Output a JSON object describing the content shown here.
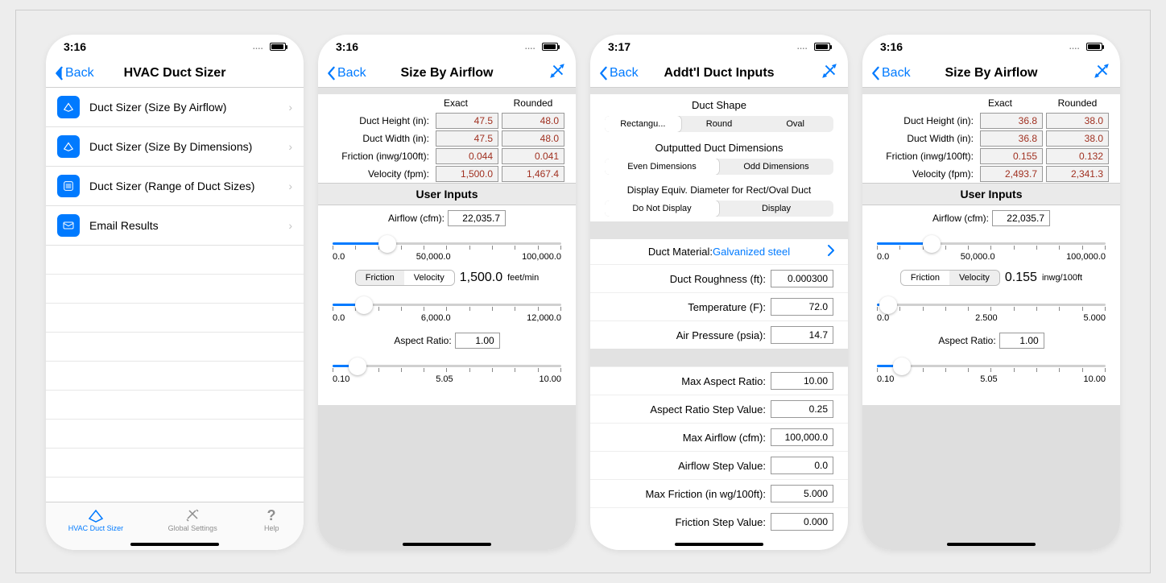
{
  "status": {
    "t1": "3:16",
    "t2": "3:16",
    "t3": "3:17",
    "t4": "3:16"
  },
  "s1": {
    "back": "Back",
    "title": "HVAC Duct Sizer",
    "rows": [
      "Duct Sizer (Size By Airflow)",
      "Duct Sizer (Size By Dimensions)",
      "Duct Sizer (Range of Duct Sizes)",
      "Email Results"
    ],
    "tabs": {
      "a": "HVAC Duct Sizer",
      "b": "Global Settings",
      "c": "Help"
    }
  },
  "s2": {
    "back": "Back",
    "title": "Size By Airflow",
    "hdr_exact": "Exact",
    "hdr_rounded": "Rounded",
    "r1l": "Duct Height (in):",
    "r1e": "47.5",
    "r1r": "48.0",
    "r2l": "Duct Width (in):",
    "r2e": "47.5",
    "r2r": "48.0",
    "r3l": "Friction (inwg/100ft):",
    "r3e": "0.044",
    "r3r": "0.041",
    "r4l": "Velocity (fpm):",
    "r4e": "1,500.0",
    "r4r": "1,467.4",
    "user_inputs": "User Inputs",
    "airflow_l": "Airflow (cfm):",
    "airflow_v": "22,035.7",
    "sl1": {
      "a": "0.0",
      "b": "50,000.0",
      "c": "100,000.0"
    },
    "seg_friction": "Friction",
    "seg_velocity": "Velocity",
    "fv_val": "1,500.0",
    "fv_unit": "feet/min",
    "sl2": {
      "a": "0.0",
      "b": "6,000.0",
      "c": "12,000.0"
    },
    "ar_l": "Aspect Ratio:",
    "ar_v": "1.00",
    "sl3": {
      "a": "0.10",
      "b": "5.05",
      "c": "10.00"
    }
  },
  "s3": {
    "back": "Back",
    "title": "Addt'l Duct Inputs",
    "shape_l": "Duct Shape",
    "shape": {
      "a": "Rectangu...",
      "b": "Round",
      "c": "Oval"
    },
    "outdim_l": "Outputted Duct Dimensions",
    "outdim": {
      "a": "Even Dimensions",
      "b": "Odd Dimensions"
    },
    "equiv_l": "Display Equiv. Diameter for Rect/Oval Duct",
    "equiv": {
      "a": "Do Not Display",
      "b": "Display"
    },
    "mat_l": "Duct Material:",
    "mat_v": "Galvanized steel",
    "rough_l": "Duct Roughness (ft):",
    "rough_v": "0.000300",
    "temp_l": "Temperature (F):",
    "temp_v": "72.0",
    "press_l": "Air Pressure (psia):",
    "press_v": "14.7",
    "maxar_l": "Max Aspect Ratio:",
    "maxar_v": "10.00",
    "arstep_l": "Aspect Ratio Step Value:",
    "arstep_v": "0.25",
    "maxaf_l": "Max Airflow (cfm):",
    "maxaf_v": "100,000.0",
    "afstep_l": "Airflow Step Value:",
    "afstep_v": "0.0",
    "maxfr_l": "Max Friction (in wg/100ft):",
    "maxfr_v": "5.000",
    "frstep_l": "Friction Step Value:",
    "frstep_v": "0.000"
  },
  "s4": {
    "back": "Back",
    "title": "Size By Airflow",
    "hdr_exact": "Exact",
    "hdr_rounded": "Rounded",
    "r1l": "Duct Height (in):",
    "r1e": "36.8",
    "r1r": "38.0",
    "r2l": "Duct Width (in):",
    "r2e": "36.8",
    "r2r": "38.0",
    "r3l": "Friction (inwg/100ft):",
    "r3e": "0.155",
    "r3r": "0.132",
    "r4l": "Velocity (fpm):",
    "r4e": "2,493.7",
    "r4r": "2,341.3",
    "user_inputs": "User Inputs",
    "airflow_l": "Airflow (cfm):",
    "airflow_v": "22,035.7",
    "sl1": {
      "a": "0.0",
      "b": "50,000.0",
      "c": "100,000.0"
    },
    "seg_friction": "Friction",
    "seg_velocity": "Velocity",
    "fv_val": "0.155",
    "fv_unit": "inwg/100ft",
    "sl2": {
      "a": "0.0",
      "b": "2.500",
      "c": "5.000"
    },
    "ar_l": "Aspect Ratio:",
    "ar_v": "1.00",
    "sl3": {
      "a": "0.10",
      "b": "5.05",
      "c": "10.00"
    }
  }
}
